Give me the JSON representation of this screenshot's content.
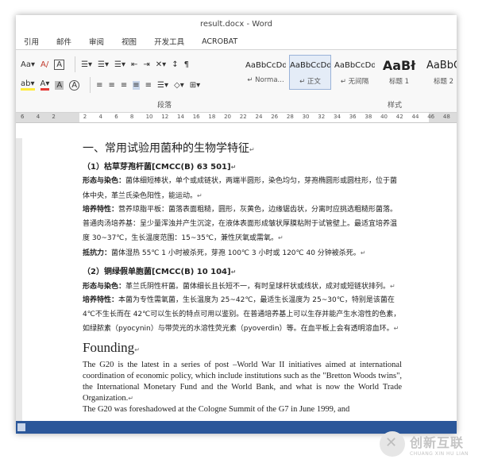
{
  "window": {
    "title": "result.docx - Word"
  },
  "menu": [
    "引用",
    "邮件",
    "审阅",
    "视图",
    "开发工具",
    "ACROBAT"
  ],
  "ribbon": {
    "row1": [
      "Aa▾",
      "A/",
      "A",
      "☰▾",
      "☰▾",
      "☰▾",
      "⇤",
      "⇥",
      "✕▾",
      "↕",
      "¶"
    ],
    "row2": [
      "ab▾",
      "A▾",
      "A",
      "A",
      "≡",
      "≡",
      "≡",
      "≡",
      "≡",
      "☰▾",
      "◇▾",
      "⊞▾"
    ],
    "group_paragraph": "段落",
    "group_styles": "样式",
    "styles": [
      {
        "sample": "AaBbCcDd",
        "name": "↵ Norma...",
        "kind": "normal"
      },
      {
        "sample": "AaBbCcDd",
        "name": "↵ 正文",
        "kind": "normal",
        "selected": true
      },
      {
        "sample": "AaBbCcDd",
        "name": "↵ 无间隔",
        "kind": "normal"
      },
      {
        "sample": "AaBł",
        "name": "标题 1",
        "kind": "big"
      },
      {
        "sample": "AaBbC",
        "name": "标题 2",
        "kind": "med"
      }
    ]
  },
  "ruler": {
    "ticks": [
      "6",
      "4",
      "2",
      "",
      "2",
      "4",
      "6",
      "8",
      "10",
      "12",
      "14",
      "16",
      "18",
      "20",
      "22",
      "24",
      "26",
      "28",
      "30",
      "32",
      "34",
      "36",
      "38",
      "40",
      "42",
      "44",
      "46",
      "48"
    ]
  },
  "doc": {
    "h1": "一、常用试验用菌种的生物学特征",
    "s1": {
      "title": "（1）枯草芽孢杆菌[CMCC(B) 63 501]",
      "p1_label": "形态与染色：",
      "p1_text": "菌体细短棒状，单个或成链状，两端半圆形，染色均匀，芽孢椭圆形或圆柱形，位于菌体中央，革兰氏染色阳性，能运动。",
      "p2_label": "培养特性：",
      "p2_text": "营养琼脂平板：菌落表面粗糙，圆形，灰黄色，边缘锯齿状，分离时应挑选粗糙形菌落。普通肉汤培养基：呈少量浑浊并产生沉淀，在液体表面形成皱状厚膜粘附于试管壁上。最适宜培养温度 30~37℃，生长温度范围：15~35℃，兼性厌氧或需氧。",
      "p3_label": "抵抗力：",
      "p3_text": "菌体湿热 55℃ 1 小时被杀死，芽孢 100℃ 3 小时或 120℃ 40 分钟被杀死。"
    },
    "s2": {
      "title": "（2）铜绿假单胞菌[CMCC(B) 10 104]",
      "p1_label": "形态与染色：",
      "p1_text": "革兰氏阴性杆菌。菌体细长且长短不一，有时呈球杆状或线状，成对或短链状排列。",
      "p2_label": "培养特性：",
      "p2_text": "本菌为专性需氧菌，生长温度为 25~42℃，最适生长温度为 25~30℃，特别是该菌在 4℃不生长而在 42℃可以生长的特点可用以鉴别。在普通培养基上可以生存并能产生水溶性的色素，如绿脓素（pyocynin）与带荧光的水溶性荧光素（pyoverdin）等。在血平板上会有透明溶血环。"
    },
    "en_heading": "Founding",
    "en_p1": "The G20 is the latest in a series of post –World War II initiatives aimed at international coordination of economic policy, which include institutions such as the \"Bretton Woods twins\", the International Monetary Fund and the World Bank, and what is now the World Trade Organization.",
    "en_p2": "The G20 was foreshadowed at the Cologne Summit of the G7 in June 1999, and",
    "pilcrow": "↵"
  },
  "watermark": {
    "cn": "创新互联",
    "en": "CHUANG XIN HU LIAN"
  }
}
